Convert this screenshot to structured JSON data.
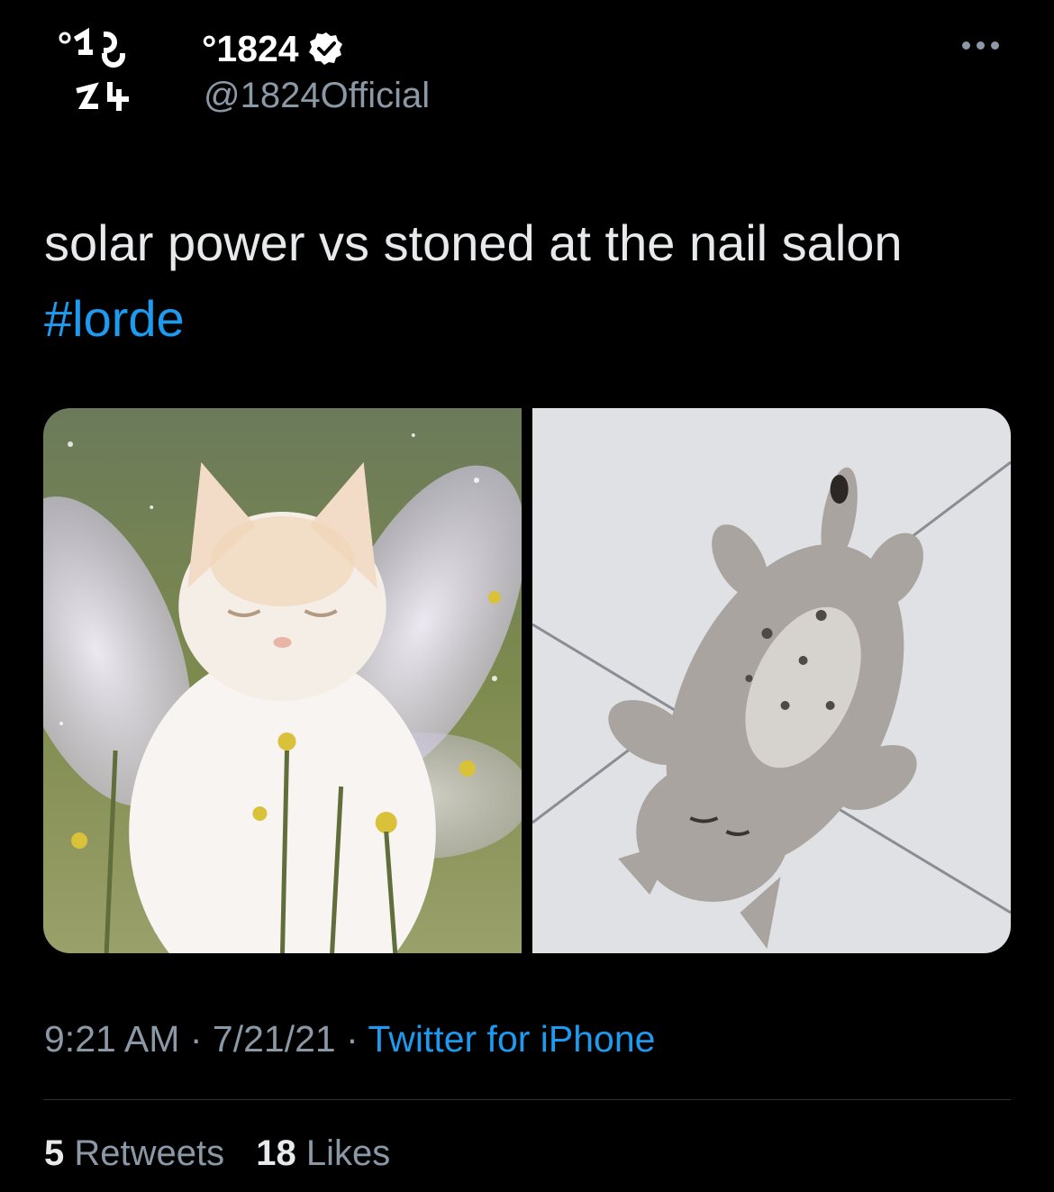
{
  "author": {
    "display_name": "°1824",
    "handle": "@1824Official",
    "verified": true,
    "avatar_icon": "1824-logo-avatar",
    "avatar_text": "°18 24"
  },
  "tweet": {
    "text": "solar power vs stoned at the nail salon",
    "hashtag": "#lorde"
  },
  "media": [
    {
      "name": "fairy-cat-image",
      "description_icon": "white-cat-with-fairy-wings"
    },
    {
      "name": "lying-cat-image",
      "description_icon": "tabby-cat-lying-on-floor"
    }
  ],
  "meta": {
    "time": "9:21 AM",
    "separator": "·",
    "date": "7/21/21",
    "source": "Twitter for iPhone"
  },
  "stats": {
    "retweets_count": "5",
    "retweets_label": "Retweets",
    "likes_count": "18",
    "likes_label": "Likes"
  },
  "colors": {
    "background": "#000000",
    "link": "#1d9bf0",
    "secondary_text": "#8b98a5",
    "primary_text": "#e7e9ea"
  }
}
